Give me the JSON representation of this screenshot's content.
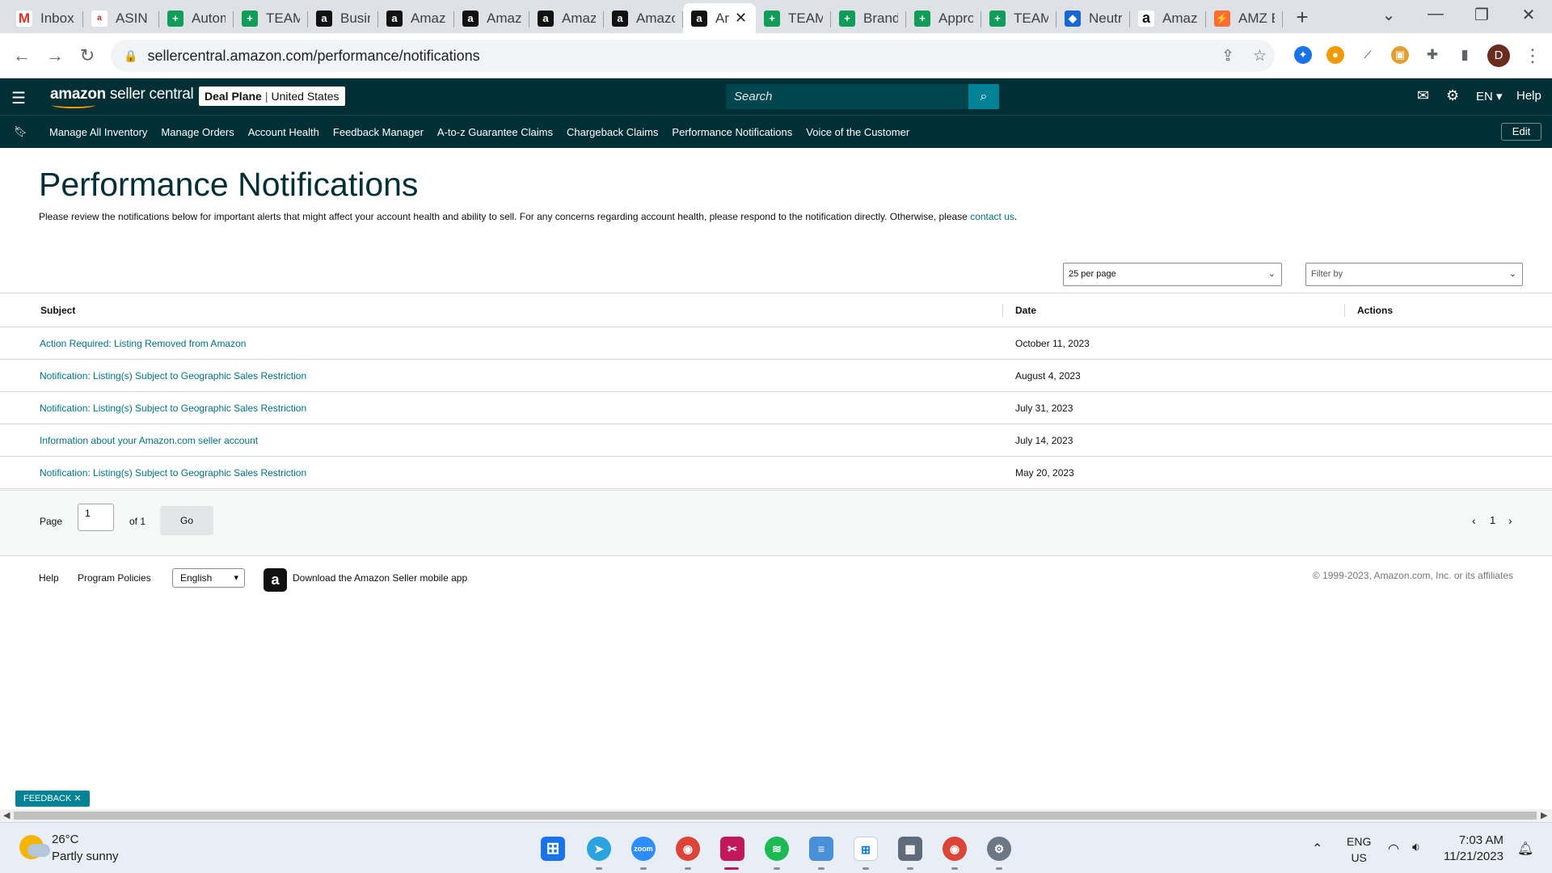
{
  "browser": {
    "tabs": [
      {
        "label": "Inbox",
        "icon": "gmail-icon",
        "fav": "gmail",
        "glyph": "M"
      },
      {
        "label": "ASIN T",
        "icon": "asin-icon",
        "fav": "asin",
        "glyph": "a"
      },
      {
        "label": "Autom",
        "icon": "sheets-icon",
        "fav": "sheet",
        "glyph": "+"
      },
      {
        "label": "TEAM",
        "icon": "sheets-icon",
        "fav": "sheet",
        "glyph": "+"
      },
      {
        "label": "Busine",
        "icon": "amazon-icon",
        "fav": "amz",
        "glyph": "a"
      },
      {
        "label": "Amazo",
        "icon": "amazon-icon",
        "fav": "amz",
        "glyph": "a"
      },
      {
        "label": "Amazo",
        "icon": "amazon-icon",
        "fav": "amz",
        "glyph": "a"
      },
      {
        "label": "Amazo",
        "icon": "amazon-icon",
        "fav": "amz",
        "glyph": "a"
      },
      {
        "label": "Amazo",
        "icon": "amazon-icon",
        "fav": "amz",
        "glyph": "a"
      },
      {
        "label": "Ar",
        "icon": "amazon-icon",
        "fav": "amz",
        "glyph": "a",
        "active": true
      },
      {
        "label": "TEAM",
        "icon": "sheets-icon",
        "fav": "sheet",
        "glyph": "+"
      },
      {
        "label": "Brand",
        "icon": "sheets-icon",
        "fav": "sheet",
        "glyph": "+"
      },
      {
        "label": "Appro",
        "icon": "sheets-icon",
        "fav": "sheet",
        "glyph": "+"
      },
      {
        "label": "TEAM",
        "icon": "sheets-icon",
        "fav": "sheet",
        "glyph": "+"
      },
      {
        "label": "Neutra",
        "icon": "neutral-icon",
        "fav": "neutral",
        "glyph": "◆"
      },
      {
        "label": "Amazo",
        "icon": "amazon-icon",
        "fav": "amzw",
        "glyph": "a"
      },
      {
        "label": "AMZ E",
        "icon": "brand-icon",
        "fav": "amzbrand",
        "glyph": "⚡"
      }
    ],
    "url": "sellercentral.amazon.com/performance/notifications",
    "profile_initial": "D"
  },
  "header": {
    "logo_bold": "amazon",
    "logo_rest": " seller central",
    "store_name": "Deal Plane",
    "marketplace": "United States",
    "search_placeholder": "Search",
    "language": "EN",
    "help": "Help"
  },
  "nav": {
    "links": [
      "Manage All Inventory",
      "Manage Orders",
      "Account Health",
      "Feedback Manager",
      "A-to-z Guarantee Claims",
      "Chargeback Claims",
      "Performance Notifications",
      "Voice of the Customer"
    ],
    "edit": "Edit"
  },
  "main": {
    "title": "Performance Notifications",
    "intro": "Please review the notifications below for important alerts that might affect your account health and ability to sell. For any concerns regarding account health, please respond to the notification directly. Otherwise, please",
    "contact_link": "contact us",
    "per_page": "25 per page",
    "filter_placeholder": "Filter by",
    "columns": {
      "subject": "Subject",
      "date": "Date",
      "actions": "Actions"
    },
    "rows": [
      {
        "subject": "Action Required: Listing Removed from Amazon",
        "date": "October 11, 2023"
      },
      {
        "subject": "Notification: Listing(s) Subject to Geographic Sales Restriction",
        "date": "August 4, 2023"
      },
      {
        "subject": "Notification: Listing(s) Subject to Geographic Sales Restriction",
        "date": "July 31, 2023"
      },
      {
        "subject": "Information about your Amazon.com seller account",
        "date": "July 14, 2023"
      },
      {
        "subject": "Notification: Listing(s) Subject to Geographic Sales Restriction",
        "date": "May 20, 2023"
      }
    ],
    "pager": {
      "label": "Page",
      "value": "1",
      "of": "of 1",
      "go": "Go",
      "current": "1"
    }
  },
  "footer": {
    "help": "Help",
    "policies": "Program Policies",
    "language": "English",
    "app_text": "Download the Amazon Seller mobile app",
    "copyright": "© 1999-2023, Amazon.com, Inc. or its affiliates"
  },
  "feedback": "FEEDBACK",
  "taskbar": {
    "temperature": "26°C",
    "weather": "Partly sunny",
    "lang_line1": "ENG",
    "lang_line2": "US",
    "time": "7:03 AM",
    "date": "11/21/2023"
  },
  "colors": {
    "header_bg": "#002f36",
    "accent_teal": "#008296",
    "link": "#007185"
  }
}
